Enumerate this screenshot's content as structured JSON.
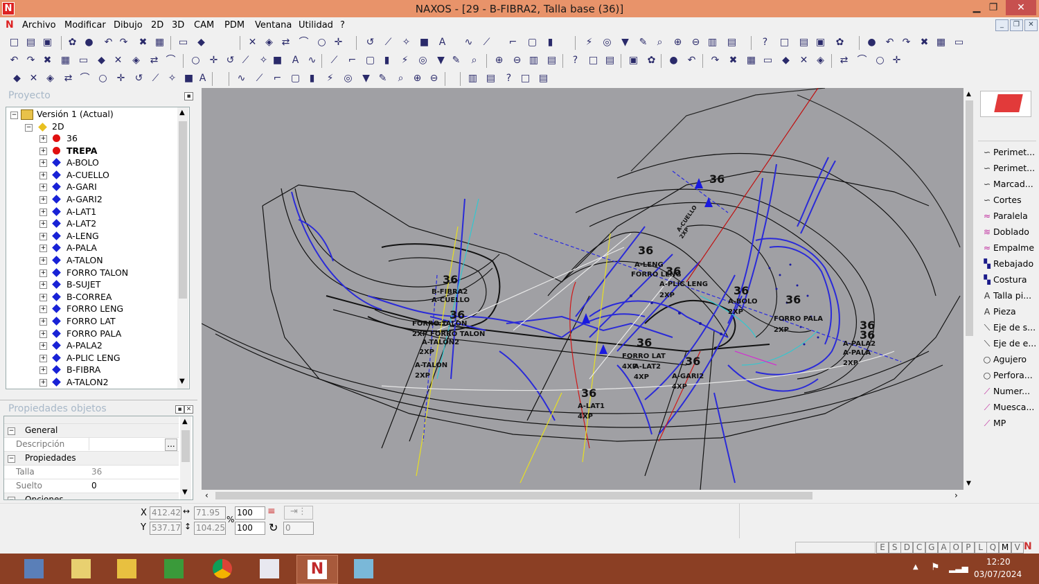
{
  "window": {
    "title": "NAXOS - [29 - B-FIBRA2, Talla base (36)]",
    "logo": "N"
  },
  "menu": [
    "Archivo",
    "Modificar",
    "Dibujo",
    "2D",
    "3D",
    "CAM",
    "PDM",
    "Ventana",
    "Utilidad",
    "?"
  ],
  "project_panel": {
    "title": "Proyecto",
    "root": "Versión 1 (Actual)",
    "node_2d": "2D",
    "items": [
      {
        "label": "36",
        "marker": "red-dot",
        "bold": false
      },
      {
        "label": "TREPA",
        "marker": "red-dot",
        "bold": true
      },
      {
        "label": "A-BOLO",
        "marker": "blue-diamond",
        "bold": false
      },
      {
        "label": "A-CUELLO",
        "marker": "blue-diamond",
        "bold": false
      },
      {
        "label": "A-GARI",
        "marker": "blue-diamond",
        "bold": false
      },
      {
        "label": "A-GARI2",
        "marker": "blue-diamond",
        "bold": false
      },
      {
        "label": "A-LAT1",
        "marker": "blue-diamond",
        "bold": false
      },
      {
        "label": "A-LAT2",
        "marker": "blue-diamond",
        "bold": false
      },
      {
        "label": "A-LENG",
        "marker": "blue-diamond",
        "bold": false
      },
      {
        "label": "A-PALA",
        "marker": "blue-diamond",
        "bold": false
      },
      {
        "label": "A-TALON",
        "marker": "blue-diamond",
        "bold": false
      },
      {
        "label": "FORRO TALON",
        "marker": "blue-diamond",
        "bold": false
      },
      {
        "label": "B-SUJET",
        "marker": "blue-diamond",
        "bold": false
      },
      {
        "label": "B-CORREA",
        "marker": "blue-diamond",
        "bold": false
      },
      {
        "label": "FORRO LENG",
        "marker": "blue-diamond",
        "bold": false
      },
      {
        "label": "FORRO LAT",
        "marker": "blue-diamond",
        "bold": false
      },
      {
        "label": "FORRO PALA",
        "marker": "blue-diamond",
        "bold": false
      },
      {
        "label": "A-PALA2",
        "marker": "blue-diamond",
        "bold": false
      },
      {
        "label": "A-PLIC LENG",
        "marker": "blue-diamond",
        "bold": false
      },
      {
        "label": "B-FIBRA",
        "marker": "blue-diamond",
        "bold": false
      },
      {
        "label": "A-TALON2",
        "marker": "blue-diamond",
        "bold": false
      }
    ]
  },
  "properties_panel": {
    "title": "Propiedades objetos",
    "groups": {
      "general": "General",
      "propiedades": "Propiedades",
      "opciones": "Opciones"
    },
    "descripcion_label": "Descripción",
    "descripcion_button": "...",
    "talla_label": "Talla",
    "talla_value": "36",
    "suelto_label": "Suelto",
    "suelto_value": "0"
  },
  "coords": {
    "x_label": "X",
    "y_label": "Y",
    "x": "412.42",
    "y": "537.17",
    "w": "71.95",
    "h": "104.25",
    "scale_x": "100",
    "scale_y": "100",
    "percent": "%",
    "rotation": "0"
  },
  "status_letters": [
    "E",
    "S",
    "D",
    "C",
    "G",
    "A",
    "O",
    "P",
    "L",
    "Q",
    "M",
    "V"
  ],
  "right_panel": {
    "items": [
      {
        "label": "Perimet...",
        "icon": "curve-icon"
      },
      {
        "label": "Perimet...",
        "icon": "curve-icon"
      },
      {
        "label": "Marcad...",
        "icon": "curve-icon"
      },
      {
        "label": "Cortes",
        "icon": "curve-icon"
      },
      {
        "label": "Paralela",
        "icon": "parallel-icon"
      },
      {
        "label": "Doblado",
        "icon": "fold-icon"
      },
      {
        "label": "Empalme",
        "icon": "join-icon"
      },
      {
        "label": "Rebajado",
        "icon": "skive-icon"
      },
      {
        "label": "Costura",
        "icon": "stitch-icon"
      },
      {
        "label": "Talla pi...",
        "icon": "text-a-icon"
      },
      {
        "label": "Pieza",
        "icon": "text-a-icon"
      },
      {
        "label": "Eje de s...",
        "icon": "axis-icon"
      },
      {
        "label": "Eje de e...",
        "icon": "axis-icon"
      },
      {
        "label": "Agujero",
        "icon": "circle-icon"
      },
      {
        "label": "Perfora...",
        "icon": "circle-icon"
      },
      {
        "label": "Numer...",
        "icon": "pen-icon"
      },
      {
        "label": "Muesca...",
        "icon": "pen-icon"
      },
      {
        "label": "MP",
        "icon": "pen-icon"
      }
    ]
  },
  "drawing": {
    "labels": [
      {
        "t": "36"
      },
      {
        "t": "A-CUELLO"
      },
      {
        "t": "2XP"
      },
      {
        "t": "36"
      },
      {
        "t": "B-FIBRA2"
      },
      {
        "t": "A-CUELLO"
      },
      {
        "t": "36"
      },
      {
        "t": "FORRO TALON"
      },
      {
        "t": "2XP"
      },
      {
        "t": "FORRO TALON"
      },
      {
        "t": "A-TALON2"
      },
      {
        "t": "2XP"
      },
      {
        "t": "A-TALON"
      },
      {
        "t": "2XP"
      },
      {
        "t": "36"
      },
      {
        "t": "A-LENG"
      },
      {
        "t": "FORRO LENG"
      },
      {
        "t": "36"
      },
      {
        "t": "A-PLIC LENG"
      },
      {
        "t": "2XP"
      },
      {
        "t": "36"
      },
      {
        "t": "A-BOLO"
      },
      {
        "t": "2XP"
      },
      {
        "t": "36"
      },
      {
        "t": "FORRO PALA"
      },
      {
        "t": "2XP"
      },
      {
        "t": "36"
      },
      {
        "t": "36"
      },
      {
        "t": "A-PALA2"
      },
      {
        "t": "A-PALA"
      },
      {
        "t": "2XP"
      },
      {
        "t": "36"
      },
      {
        "t": "FORRO LAT"
      },
      {
        "t": "4XP"
      },
      {
        "t": "A-LAT2"
      },
      {
        "t": "4XP"
      },
      {
        "t": "36"
      },
      {
        "t": "A-GARI2"
      },
      {
        "t": "4XP"
      },
      {
        "t": "36"
      },
      {
        "t": "A-LAT1"
      },
      {
        "t": "4XP"
      }
    ]
  },
  "taskbar": {
    "time": "12:20",
    "date": "03/07/2024",
    "apps": [
      {
        "name": "calculator-icon"
      },
      {
        "name": "file-manager-icon"
      },
      {
        "name": "folder-icon"
      },
      {
        "name": "green-app-icon"
      },
      {
        "name": "chrome-icon"
      },
      {
        "name": "document-app-icon"
      },
      {
        "name": "naxos-icon"
      },
      {
        "name": "tool-app-icon"
      }
    ]
  },
  "colors": {
    "titlebar": "#e8936a",
    "canvas": "#a0a0a4",
    "taskbar": "#8b3f24",
    "pattern_blue": "#2a2ad8",
    "close": "#c7504f"
  }
}
